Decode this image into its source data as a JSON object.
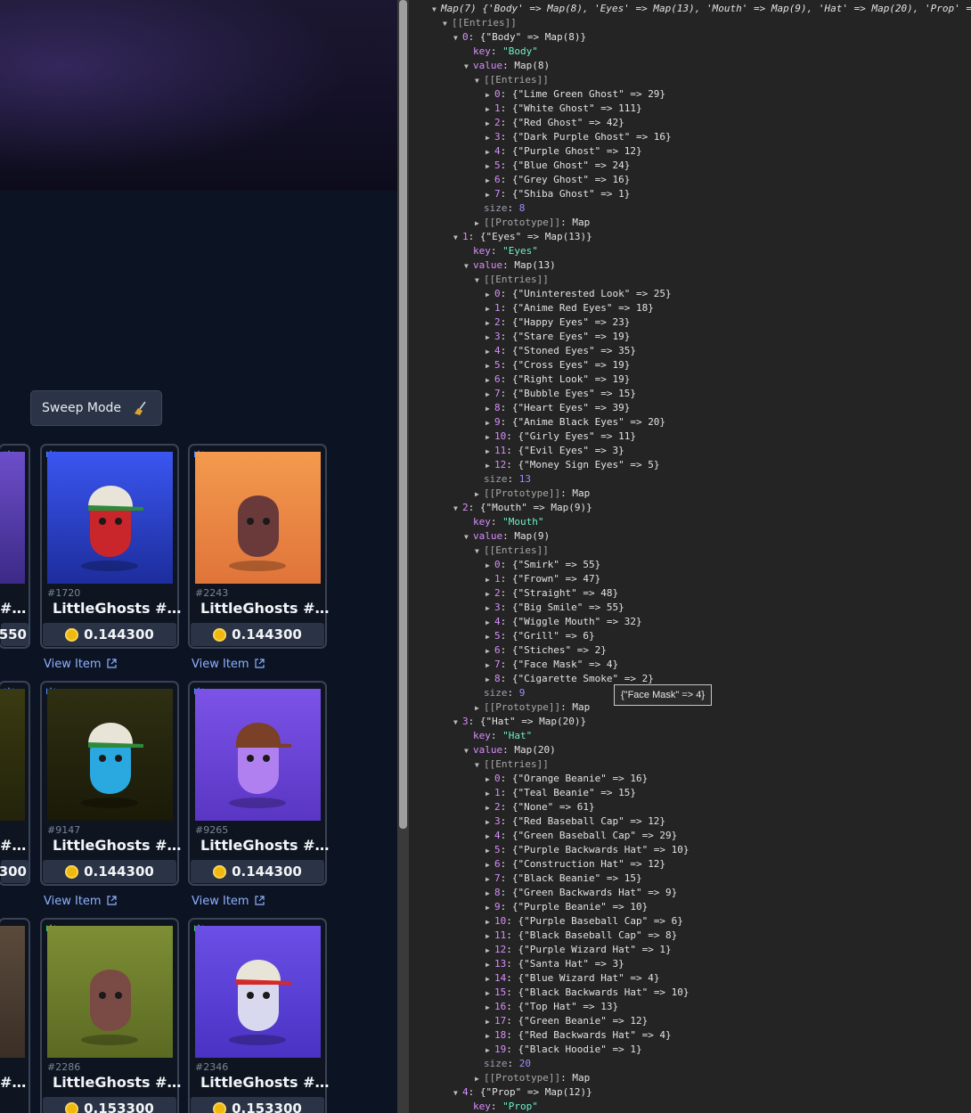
{
  "toolbar": {
    "sweep_label": "Sweep Mode"
  },
  "view_item_label": "View Item",
  "cards": [
    {
      "num": "",
      "name": "#…",
      "price": "550",
      "badge": "crown-blue",
      "bg": [
        "#6c4ec9",
        "#3c2a86"
      ]
    },
    {
      "num": "#1720",
      "name": "LittleGhosts #…",
      "price": "0.144300",
      "badge": "crown-blue",
      "bg": [
        "#3a56f0",
        "#1d2d9c"
      ],
      "ghost": "#c8262a",
      "hat": "#e8e4d8",
      "brim": "#2d8a3b"
    },
    {
      "num": "#2243",
      "name": "LittleGhosts #…",
      "price": "0.144300",
      "badge": "crown-blue",
      "bg": [
        "#f39a4e",
        "#e0743a"
      ],
      "ghost": "#6a3a3a"
    },
    {
      "num": "",
      "name": "#…",
      "price": "300",
      "badge": "crown-blue",
      "bg": [
        "#3a3a12",
        "#23230b"
      ]
    },
    {
      "num": "#9147",
      "name": "LittleGhosts #…",
      "price": "0.144300",
      "badge": "crown-blue",
      "bg": [
        "#2e2f12",
        "#1a1a08"
      ],
      "ghost": "#2aa8e0",
      "hat": "#e8e4d8",
      "brim": "#2d8a3b"
    },
    {
      "num": "#9265",
      "name": "LittleGhosts #…",
      "price": "0.144300",
      "badge": "crown-blue",
      "bg": [
        "#7b53e8",
        "#5a36c4"
      ],
      "ghost": "#b080f0",
      "hat": "#7a4028",
      "brim": "#7a4028"
    },
    {
      "num": "",
      "name": "#…",
      "price": "",
      "badge": "",
      "bg": [
        "#5a4a3c",
        "#3a2f26"
      ]
    },
    {
      "num": "#2286",
      "name": "LittleGhosts #…",
      "price": "0.153300",
      "badge": "crown-green",
      "bg": [
        "#7d8e35",
        "#5b6a22"
      ],
      "ghost": "#7a4a44"
    },
    {
      "num": "#2346",
      "name": "LittleGhosts #…",
      "price": "0.153300",
      "badge": "crown-green",
      "bg": [
        "#6b4fe6",
        "#4a32c4"
      ],
      "ghost": "#d8d8ee",
      "hat": "#e8e4d8",
      "brim": "#d42a2a"
    }
  ],
  "console": {
    "header": "Map(7) {'Body' => Map(8), 'Eyes' => Map(13), 'Mouth' => Map(9), 'Hat' => Map(20), 'Prop' =",
    "entries_label": "[[Entries]]",
    "prototype_label": "[[Prototype]]",
    "prototype_value": "Map",
    "groups": [
      {
        "index": "0",
        "key": "Body",
        "count": "8",
        "items": [
          "Lime Green Ghost\" => 29",
          "White Ghost\" => 111",
          "Red Ghost\" => 42",
          "Dark Purple Ghost\" => 16",
          "Purple Ghost\" => 12",
          "Blue Ghost\" => 24",
          "Grey Ghost\" => 16",
          "Shiba Ghost\" => 1"
        ]
      },
      {
        "index": "1",
        "key": "Eyes",
        "count": "13",
        "items": [
          "Uninterested Look\" => 25",
          "Anime Red Eyes\" => 18",
          "Happy Eyes\" => 23",
          "Stare Eyes\" => 19",
          "Stoned Eyes\" => 35",
          "Cross Eyes\" => 19",
          "Right Look\" => 19",
          "Bubble Eyes\" => 15",
          "Heart Eyes\" => 39",
          "Anime Black Eyes\" => 20",
          "Girly Eyes\" => 11",
          "Evil Eyes\" => 3",
          "Money Sign Eyes\" => 5"
        ]
      },
      {
        "index": "2",
        "key": "Mouth",
        "count": "9",
        "items": [
          "Smirk\" => 55",
          "Frown\" => 47",
          "Straight\" => 48",
          "Big Smile\" => 55",
          "Wiggle Mouth\" => 32",
          "Grill\" => 6",
          "Stiches\" => 2",
          "Face Mask\" => 4",
          "Cigarette Smoke\" => 2"
        ]
      },
      {
        "index": "3",
        "key": "Hat",
        "count": "20",
        "items": [
          "Orange Beanie\" => 16",
          "Teal Beanie\" => 15",
          "None\" => 61",
          "Red Baseball Cap\" => 12",
          "Green Baseball Cap\" => 29",
          "Purple Backwards Hat\" => 10",
          "Construction Hat\" => 12",
          "Black Beanie\" => 15",
          "Green Backwards Hat\" => 9",
          "Purple Beanie\" => 10",
          "Purple Baseball Cap\" => 6",
          "Black Baseball Cap\" => 8",
          "Purple Wizard Hat\" => 1",
          "Santa Hat\" => 3",
          "Blue Wizard Hat\" => 4",
          "Black Backwards Hat\" => 10",
          "Top Hat\" => 13",
          "Green Beanie\" => 12",
          "Red Backwards Hat\" => 4",
          "Black Hoodie\" => 1"
        ]
      },
      {
        "index": "4",
        "key": "Prop",
        "count": "12",
        "items": []
      }
    ],
    "tooltip": "{\"Face Mask\" => 4}"
  }
}
